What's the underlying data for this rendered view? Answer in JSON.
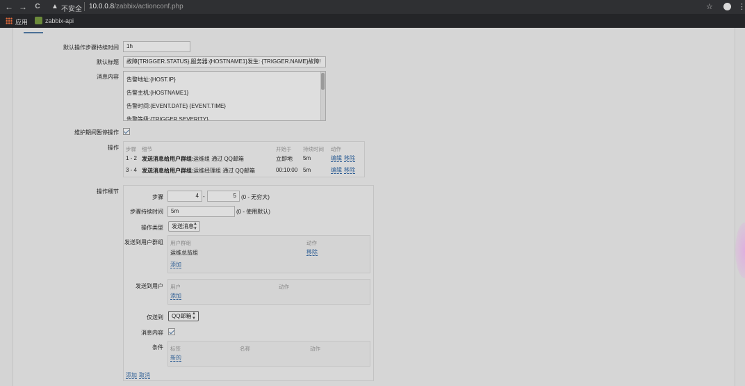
{
  "browser": {
    "back": "←",
    "forward": "→",
    "reload": "C",
    "security_warning": "▲",
    "security_label": "不安全",
    "url_host": "10.0.0.8",
    "url_path": "/zabbix/actionconf.php",
    "star": "☆",
    "menu": "⋮",
    "bookmarks": {
      "apps": "应用",
      "zabbix": "zabbix-api"
    }
  },
  "form": {
    "default_step_duration": {
      "label": "默认操作步骤持续时间",
      "value": "1h"
    },
    "default_subject": {
      "label": "默认标题",
      "value": "故障{TRIGGER.STATUS},服务器:{HOSTNAME1}发生: {TRIGGER.NAME}故障!"
    },
    "default_message": {
      "label": "消息内容",
      "lines": [
        "告警地址:{HOST.IP}",
        "告警主机:{HOSTNAME1}",
        "告警时间:{EVENT.DATE} {EVENT.TIME}",
        "告警等级:{TRIGGER.SEVERITY}"
      ]
    },
    "pause_maintenance": {
      "label": "维护期间暂停操作",
      "checked": true
    },
    "operations": {
      "label": "操作",
      "headers": {
        "steps": "步骤",
        "details": "细节",
        "start": "开始于",
        "duration": "持续时间",
        "action": "动作"
      },
      "rows": [
        {
          "steps": "1 - 2",
          "details_bold": "发送消息给用户群组:",
          "details": "运维组 通过 QQ邮箱",
          "start": "立即地",
          "duration": "5m",
          "edit": "编辑",
          "remove": "移除"
        },
        {
          "steps": "3 - 4",
          "details_bold": "发送消息给用户群组:",
          "details": "运维经理组 通过 QQ邮箱",
          "start": "00:10:00",
          "duration": "5m",
          "edit": "编辑",
          "remove": "移除"
        }
      ]
    },
    "operation_details": {
      "label": "操作细节",
      "steps": {
        "label": "步骤",
        "from": "4",
        "dash": "-",
        "to": "5",
        "hint": "(0 - 无穷大)"
      },
      "step_duration": {
        "label": "步骤持续时间",
        "value": "5m",
        "hint": "(0 - 使用默认)"
      },
      "operation_type": {
        "label": "操作类型",
        "value": "发送消息"
      },
      "send_to_groups": {
        "label": "发送到用户群组",
        "col_group": "用户群组",
        "col_action": "动作",
        "item": "运维总监组",
        "remove": "移除",
        "add": "添加"
      },
      "send_to_users": {
        "label": "发送到用户",
        "col_user": "用户",
        "col_action": "动作",
        "add": "添加"
      },
      "send_only_to": {
        "label": "仅送到",
        "value": "QQ邮箱"
      },
      "default_message": {
        "label": "消息内容",
        "checked": true
      },
      "conditions": {
        "label": "条件",
        "col_label": "标签",
        "col_name": "名称",
        "col_action": "动作",
        "new": "新的"
      },
      "add": "添加",
      "cancel": "取消"
    }
  },
  "colors": {
    "link": "#2f5f95",
    "chrome": "#2f3033",
    "accent": "#4a6f96"
  }
}
